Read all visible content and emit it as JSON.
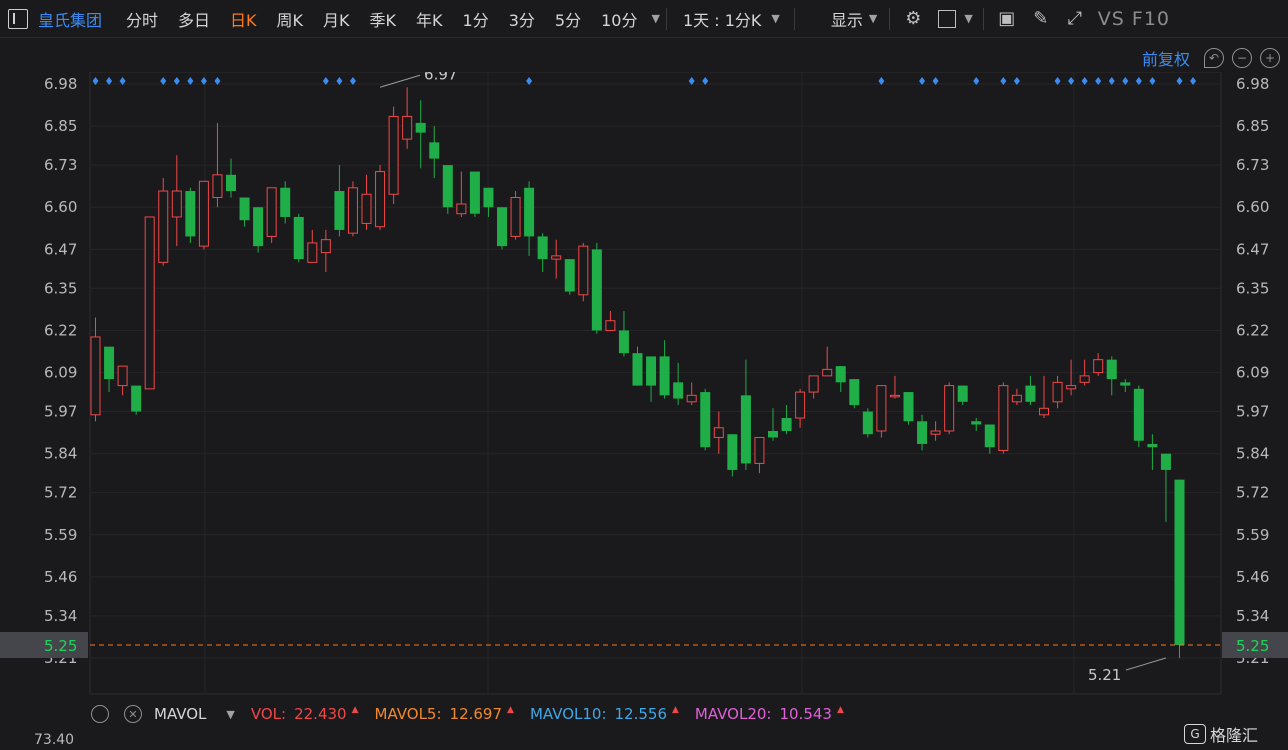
{
  "toolbar": {
    "stock_name": "皇氏集团",
    "periods": [
      "分时",
      "多日",
      "日K",
      "周K",
      "月K",
      "季K",
      "年K",
      "1分",
      "3分",
      "5分",
      "10分"
    ],
    "active_period": "日K",
    "interval_label": "1天 : 1分K",
    "display_label": "显示",
    "vs_f10": "VS F10"
  },
  "subbar": {
    "adjust_label": "前复权"
  },
  "volume_bar": {
    "indicator": "MAVOL",
    "items": [
      {
        "key": "VOL:",
        "value": "22.430",
        "color": "#f04848"
      },
      {
        "key": "MAVOL5:",
        "value": "12.697",
        "color": "#f0892d"
      },
      {
        "key": "MAVOL10:",
        "value": "12.556",
        "color": "#3ea7e6"
      },
      {
        "key": "MAVOL20:",
        "value": "10.543",
        "color": "#e060d8"
      }
    ],
    "axis_top": "73.40"
  },
  "watermark": "格隆汇",
  "colors": {
    "up": "#f04848",
    "down": "#1fae48",
    "accent": "#ff7a1a",
    "link": "#3b8cf2",
    "marker": "#3b8cf2"
  },
  "chart_data": {
    "type": "candlestick",
    "y_ticks": [
      "6.98",
      "6.85",
      "6.73",
      "6.60",
      "6.47",
      "6.35",
      "6.22",
      "6.09",
      "5.97",
      "5.84",
      "5.72",
      "5.59",
      "5.46",
      "5.34",
      "5.21"
    ],
    "ylim": [
      5.18,
      7.03
    ],
    "last_price": "5.25",
    "last_value": 5.25,
    "high_label": {
      "index": 21,
      "value": 6.97,
      "text": "6.97"
    },
    "low_label": {
      "index": 79,
      "value": 5.21,
      "text": "5.21"
    },
    "marker_indices": [
      0,
      1,
      2,
      5,
      6,
      7,
      8,
      9,
      17,
      18,
      19,
      32,
      44,
      45,
      58,
      61,
      62,
      65,
      67,
      68,
      71,
      72,
      73,
      74,
      75,
      76,
      77,
      78,
      80,
      81
    ],
    "ohlc": [
      [
        5.96,
        6.2,
        6.26,
        5.94
      ],
      [
        6.17,
        6.07,
        6.17,
        6.03
      ],
      [
        6.05,
        6.11,
        6.11,
        6.02
      ],
      [
        6.05,
        5.97,
        6.05,
        5.96
      ],
      [
        6.04,
        6.57,
        6.57,
        6.04
      ],
      [
        6.43,
        6.65,
        6.69,
        6.42
      ],
      [
        6.57,
        6.65,
        6.76,
        6.48
      ],
      [
        6.65,
        6.51,
        6.66,
        6.49
      ],
      [
        6.48,
        6.68,
        6.68,
        6.47
      ],
      [
        6.63,
        6.7,
        6.86,
        6.6
      ],
      [
        6.7,
        6.65,
        6.75,
        6.63
      ],
      [
        6.63,
        6.56,
        6.63,
        6.54
      ],
      [
        6.6,
        6.48,
        6.6,
        6.46
      ],
      [
        6.51,
        6.66,
        6.66,
        6.49
      ],
      [
        6.66,
        6.57,
        6.68,
        6.55
      ],
      [
        6.57,
        6.44,
        6.58,
        6.43
      ],
      [
        6.43,
        6.49,
        6.53,
        6.43
      ],
      [
        6.46,
        6.5,
        6.53,
        6.4
      ],
      [
        6.65,
        6.53,
        6.73,
        6.51
      ],
      [
        6.52,
        6.66,
        6.68,
        6.51
      ],
      [
        6.55,
        6.64,
        6.7,
        6.53
      ],
      [
        6.54,
        6.71,
        6.73,
        6.53
      ],
      [
        6.64,
        6.88,
        6.91,
        6.61
      ],
      [
        6.81,
        6.88,
        6.97,
        6.78
      ],
      [
        6.86,
        6.83,
        6.93,
        6.72
      ],
      [
        6.8,
        6.75,
        6.85,
        6.69
      ],
      [
        6.73,
        6.6,
        6.73,
        6.58
      ],
      [
        6.58,
        6.61,
        6.71,
        6.57
      ],
      [
        6.71,
        6.58,
        6.71,
        6.57
      ],
      [
        6.66,
        6.6,
        6.66,
        6.57
      ],
      [
        6.6,
        6.48,
        6.6,
        6.47
      ],
      [
        6.51,
        6.63,
        6.65,
        6.5
      ],
      [
        6.66,
        6.51,
        6.68,
        6.45
      ],
      [
        6.51,
        6.44,
        6.52,
        6.4
      ],
      [
        6.44,
        6.45,
        6.5,
        6.38
      ],
      [
        6.44,
        6.34,
        6.44,
        6.33
      ],
      [
        6.33,
        6.48,
        6.49,
        6.31
      ],
      [
        6.47,
        6.22,
        6.49,
        6.21
      ],
      [
        6.22,
        6.25,
        6.28,
        6.22
      ],
      [
        6.22,
        6.15,
        6.28,
        6.14
      ],
      [
        6.15,
        6.05,
        6.17,
        6.05
      ],
      [
        6.14,
        6.05,
        6.14,
        6.0
      ],
      [
        6.14,
        6.02,
        6.19,
        6.01
      ],
      [
        6.06,
        6.01,
        6.12,
        5.99
      ],
      [
        6.0,
        6.02,
        6.06,
        5.99
      ],
      [
        6.03,
        5.86,
        6.04,
        5.85
      ],
      [
        5.89,
        5.92,
        5.97,
        5.84
      ],
      [
        5.9,
        5.79,
        5.9,
        5.77
      ],
      [
        6.02,
        5.81,
        6.13,
        5.79
      ],
      [
        5.81,
        5.89,
        5.89,
        5.78
      ],
      [
        5.91,
        5.89,
        5.98,
        5.88
      ],
      [
        5.95,
        5.91,
        5.99,
        5.9
      ],
      [
        5.95,
        6.03,
        6.04,
        5.92
      ],
      [
        6.03,
        6.08,
        6.08,
        6.01
      ],
      [
        6.08,
        6.1,
        6.17,
        6.08
      ],
      [
        6.11,
        6.06,
        6.11,
        6.03
      ],
      [
        6.07,
        5.99,
        6.07,
        5.98
      ],
      [
        5.97,
        5.9,
        5.98,
        5.89
      ],
      [
        5.91,
        6.05,
        6.05,
        5.89
      ],
      [
        6.02,
        6.02,
        6.08,
        6.01
      ],
      [
        6.03,
        5.94,
        6.03,
        5.93
      ],
      [
        5.94,
        5.87,
        5.96,
        5.85
      ],
      [
        5.9,
        5.91,
        5.94,
        5.88
      ],
      [
        5.91,
        6.05,
        6.06,
        5.9
      ],
      [
        6.05,
        6.0,
        6.05,
        5.99
      ],
      [
        5.94,
        5.93,
        5.95,
        5.91
      ],
      [
        5.93,
        5.86,
        5.93,
        5.84
      ],
      [
        5.85,
        6.05,
        6.06,
        5.84
      ],
      [
        6.0,
        6.02,
        6.04,
        5.99
      ],
      [
        6.05,
        6.0,
        6.08,
        5.99
      ],
      [
        5.96,
        5.98,
        6.08,
        5.95
      ],
      [
        6.0,
        6.06,
        6.08,
        5.98
      ],
      [
        6.04,
        6.05,
        6.13,
        6.02
      ],
      [
        6.06,
        6.08,
        6.13,
        6.05
      ],
      [
        6.09,
        6.13,
        6.15,
        6.08
      ],
      [
        6.13,
        6.07,
        6.14,
        6.02
      ],
      [
        6.06,
        6.05,
        6.07,
        6.03
      ],
      [
        6.04,
        5.88,
        6.05,
        5.86
      ],
      [
        5.87,
        5.86,
        5.9,
        5.79
      ],
      [
        5.84,
        5.79,
        5.84,
        5.63
      ],
      [
        5.76,
        5.25,
        5.76,
        5.21
      ]
    ]
  }
}
